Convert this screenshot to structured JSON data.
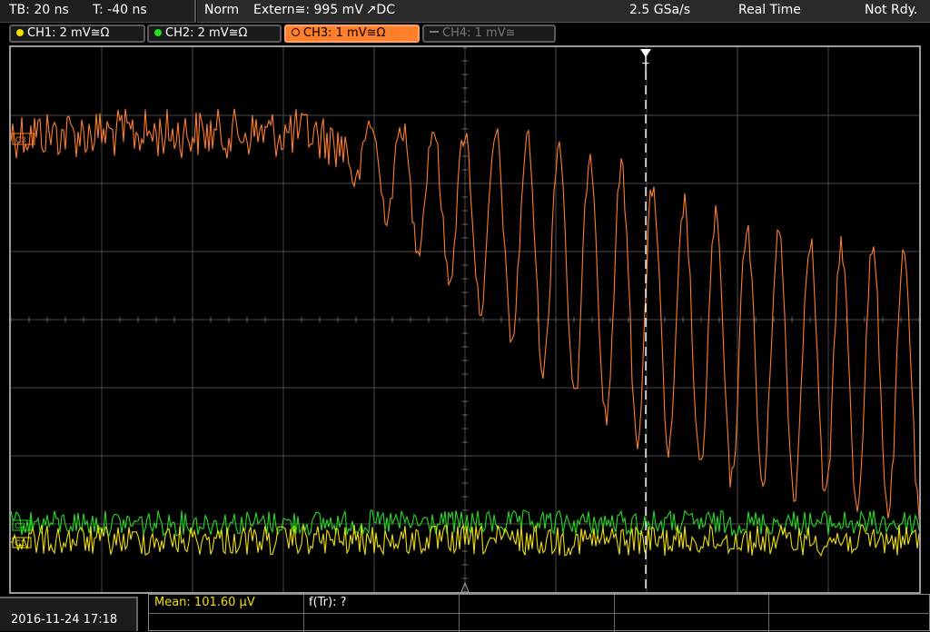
{
  "status": {
    "tb": "TB: 20 ns",
    "t": "T: -40 ns",
    "mode": "Norm",
    "trigger": "Extern≅: 995 mV ↗DC",
    "rate": "2.5 GSa/s",
    "acq": "Real Time",
    "state": "Not Rdy."
  },
  "channels": [
    {
      "label": "CH1: 2 mV≅Ω",
      "color": "#f0e000",
      "active": false
    },
    {
      "label": "CH2: 2 mV≅Ω",
      "color": "#22dd22",
      "active": false
    },
    {
      "label": "CH3: 1 mV≅Ω",
      "color": "#ff7f2a",
      "active": true
    },
    {
      "label": "CH4: 1 mV≅",
      "color": "#777777",
      "active": false
    }
  ],
  "markers": {
    "ch3": "C3",
    "ch2": "C2",
    "ch1": "C1",
    "trigger": "T"
  },
  "footer": {
    "datetime": "2016-11-24 17:18",
    "mean": "Mean: 101.60 µV",
    "ftr": "f(Tr): ?"
  },
  "colors": {
    "ch1": "#f0e000",
    "ch2": "#22dd22",
    "ch3": "#ff7f2a",
    "grid": "#5a5a5a"
  }
}
